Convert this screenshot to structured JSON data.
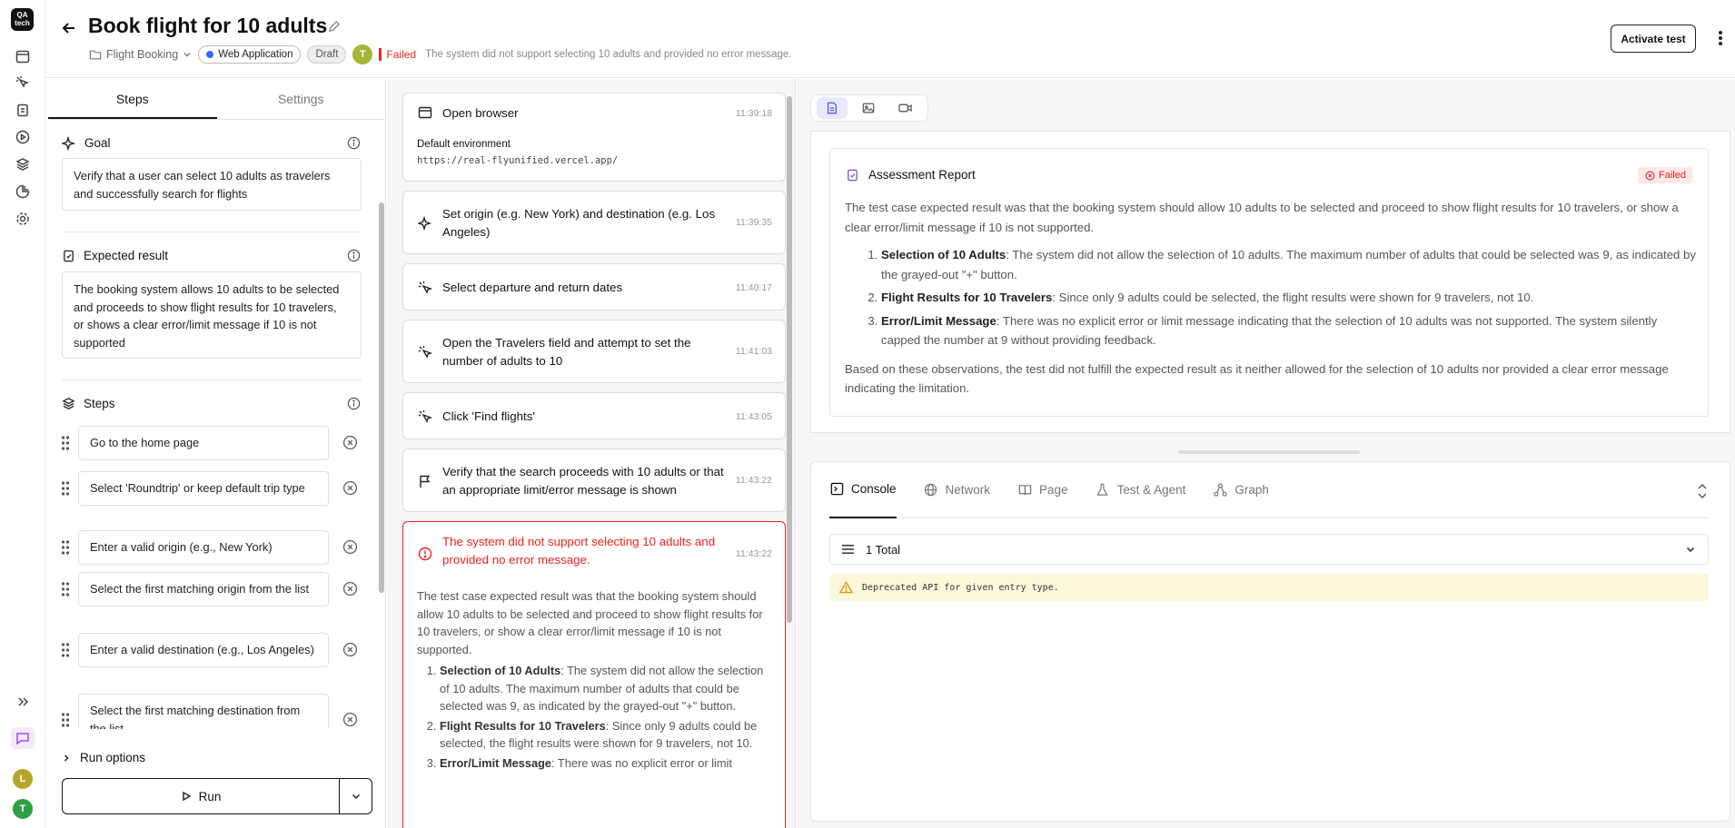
{
  "rail": {
    "logo": "QA tech",
    "avatars": [
      {
        "letter": "L",
        "color": "#b5a52a"
      },
      {
        "letter": "T",
        "color": "#2f9e44"
      }
    ]
  },
  "header": {
    "title": "Book flight for 10 adults",
    "breadcrumb": "Flight Booking",
    "app_type": "Web Application",
    "status": "Draft",
    "avatar": "T",
    "result": "Failed",
    "result_message": "The system did not support selecting 10 adults and provided no error message.",
    "activate_label": "Activate test"
  },
  "left": {
    "tabs": [
      "Steps",
      "Settings"
    ],
    "goal_label": "Goal",
    "goal": "Verify that a user can select 10 adults as travelers and successfully search for flights",
    "expected_label": "Expected result",
    "expected": "The booking system allows 10 adults to be selected and proceeds to show flight results for 10 travelers, or shows a clear error/limit message if 10 is not supported",
    "steps_label": "Steps",
    "steps": [
      "Go to the home page",
      "Select 'Roundtrip' or keep default trip type",
      "Enter a valid origin (e.g., New York)",
      "Select the first matching origin from the list",
      "Enter a valid destination (e.g., Los Angeles)",
      "Select the first matching destination from the list"
    ],
    "run_options": "Run options",
    "run_label": "Run"
  },
  "timeline": {
    "items": [
      {
        "title": "Open browser",
        "time": "11:39:18",
        "env_label": "Default environment",
        "url": "https://real-flyunified.vercel.app/"
      },
      {
        "title": "Set origin (e.g. New York) and destination (e.g. Los Angeles)",
        "time": "11:39:35"
      },
      {
        "title": "Select departure and return dates",
        "time": "11:40:17"
      },
      {
        "title": "Open the Travelers field and attempt to set the number of adults to 10",
        "time": "11:41:03"
      },
      {
        "title": "Click 'Find flights'",
        "time": "11:43:05"
      },
      {
        "title": "Verify that the search proceeds with 10 adults or that an appropriate limit/error message is shown",
        "time": "11:43:22"
      }
    ],
    "failure": {
      "title": "The system did not support selecting 10 adults and provided no error message.",
      "time": "11:43:22",
      "intro": "The test case expected result was that the booking system should allow 10 adults to be selected and proceed to show flight results for 10 travelers, or show a clear error/limit message if 10 is not supported.",
      "points": [
        {
          "label": "Selection of 10 Adults",
          "text": ": The system did not allow the selection of 10 adults. The maximum number of adults that could be selected was 9, as indicated by the grayed-out \"+\" button."
        },
        {
          "label": "Flight Results for 10 Travelers",
          "text": ": Since only 9 adults could be selected, the flight results were shown for 9 travelers, not 10."
        },
        {
          "label": "Error/Limit Message",
          "text": ": There was no explicit error or limit"
        }
      ]
    }
  },
  "report": {
    "title": "Assessment Report",
    "badge": "Failed",
    "intro": "The test case expected result was that the booking system should allow 10 adults to be selected and proceed to show flight results for 10 travelers, or show a clear error/limit message if 10 is not supported.",
    "points": [
      {
        "label": "Selection of 10 Adults",
        "text": ": The system did not allow the selection of 10 adults. The maximum number of adults that could be selected was 9, as indicated by the grayed-out \"+\" button."
      },
      {
        "label": "Flight Results for 10 Travelers",
        "text": ": Since only 9 adults could be selected, the flight results were shown for 9 travelers, not 10."
      },
      {
        "label": "Error/Limit Message",
        "text": ": There was no explicit error or limit message indicating that the selection of 10 adults was not supported. The system silently capped the number at 9 without providing feedback."
      }
    ],
    "conclusion": "Based on these observations, the test did not fulfill the expected result as it neither allowed for the selection of 10 adults nor provided a clear error message indicating the limitation."
  },
  "console": {
    "tabs": [
      "Console",
      "Network",
      "Page",
      "Test & Agent",
      "Graph"
    ],
    "total": "1 Total",
    "warning": "Deprecated API for given entry type."
  },
  "colors": {
    "failed": "#e22222",
    "accent": "#5a5bd6",
    "warning_bg": "#fdf7dc"
  }
}
